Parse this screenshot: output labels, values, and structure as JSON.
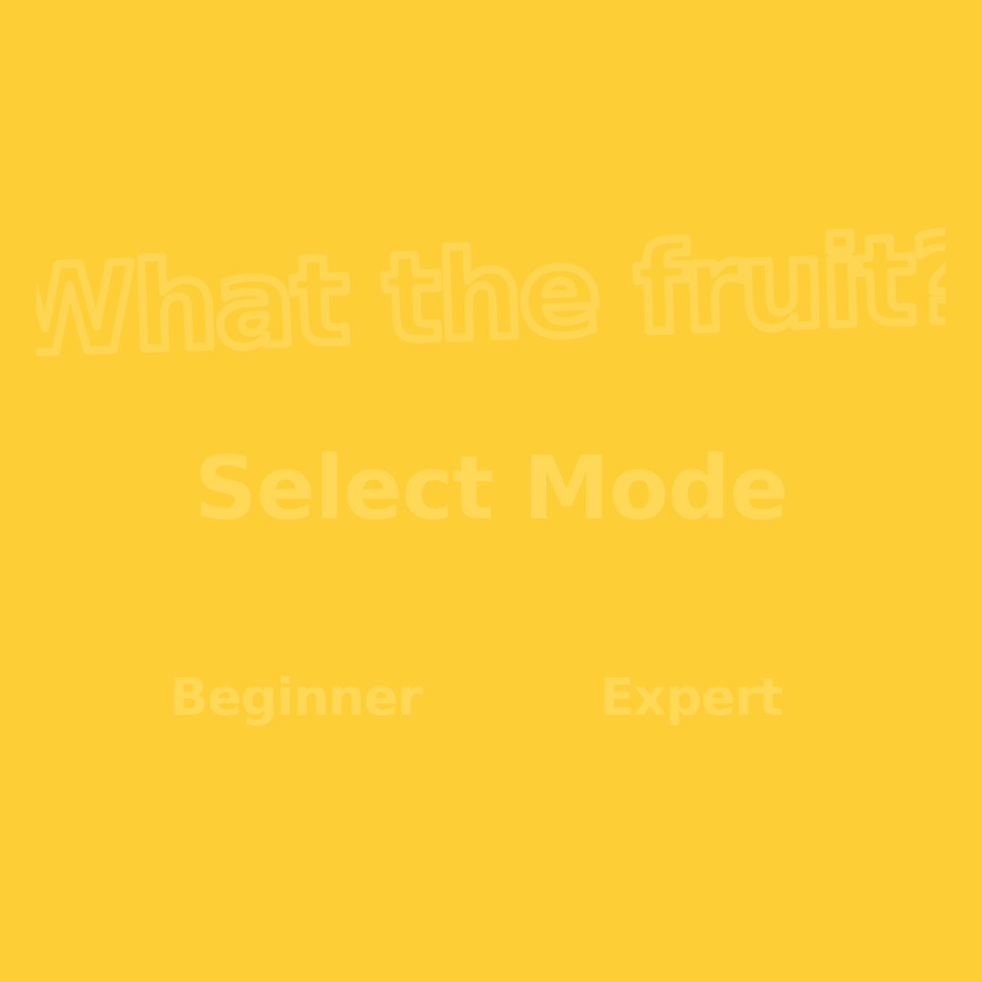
{
  "game": {
    "title": "What the fruit?",
    "subtitle": "Select Mode",
    "modes": {
      "beginner_label": "Beginner",
      "expert_label": "Expert"
    }
  },
  "colors": {
    "background": "#FECE37",
    "text_faint": "#FFD857",
    "outline_faint": "#FFD654"
  }
}
